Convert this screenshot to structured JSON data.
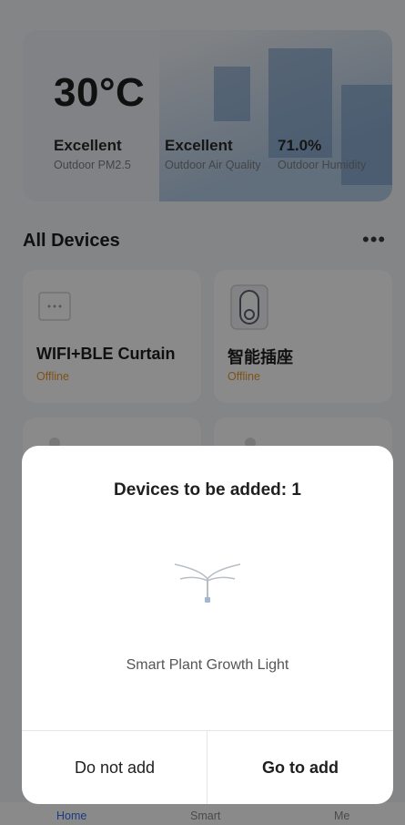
{
  "weather": {
    "temperature": "30°C",
    "stats": [
      {
        "value": "Excellent",
        "label": "Outdoor PM2.5"
      },
      {
        "value": "Excellent",
        "label": "Outdoor Air Quality"
      },
      {
        "value": "71.0%",
        "label": "Outdoor Humidity"
      }
    ]
  },
  "devices_section": {
    "title": "All Devices",
    "devices": [
      {
        "name": "WIFI+BLE Curtain",
        "status": "Offline",
        "icon": "curtain-switch-icon"
      },
      {
        "name": "智能插座",
        "status": "Offline",
        "icon": "smart-socket-icon"
      }
    ]
  },
  "tabbar": {
    "tabs": [
      {
        "label": "Home",
        "active": true
      },
      {
        "label": "Smart",
        "active": false
      },
      {
        "label": "Me",
        "active": false
      }
    ]
  },
  "modal": {
    "title": "Devices to be added: 1",
    "device_name": "Smart Plant Growth Light",
    "device_icon": "plant-growth-light-icon",
    "cancel_label": "Do not add",
    "confirm_label": "Go to add"
  },
  "colors": {
    "offline_status": "#e8972b",
    "active_tab": "#2f6ff0"
  }
}
